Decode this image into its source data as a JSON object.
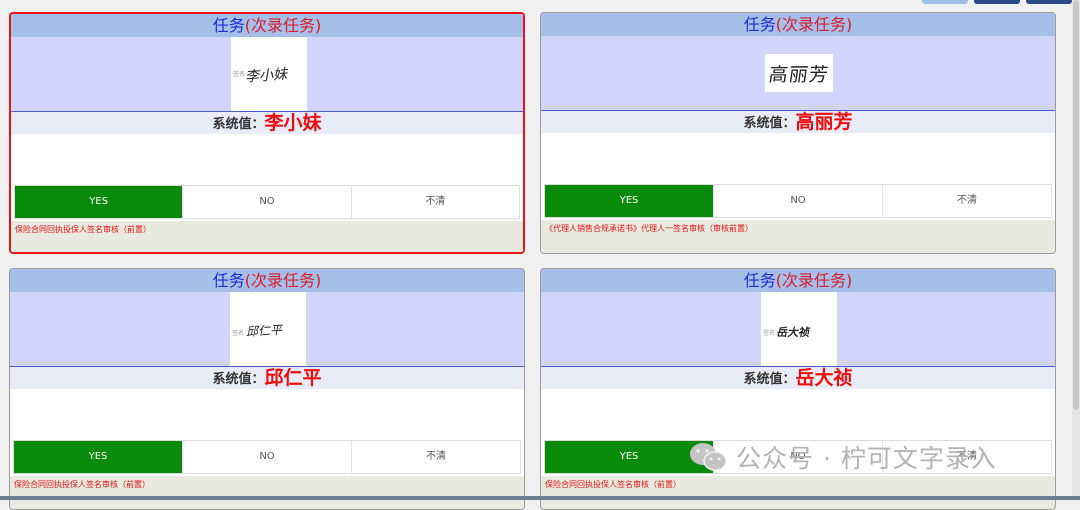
{
  "cards": [
    {
      "header_title": "任务",
      "header_sub": "(次录任务)",
      "sig_text": "李小妹",
      "sig_prefix": "签名",
      "sys_label": "系统值：",
      "sys_value": "李小妹",
      "options": [
        "YES",
        "NO",
        "不清"
      ],
      "selected_option": "YES",
      "footer_text": "保险合同回执投保人签名审核（前置）",
      "selected": true
    },
    {
      "header_title": "任务",
      "header_sub": "(次录任务)",
      "sig_text": "高丽芳",
      "sig_prefix": "",
      "sys_label": "系统值：",
      "sys_value": "高丽芳",
      "options": [
        "YES",
        "NO",
        "不清"
      ],
      "selected_option": "YES",
      "footer_text": "《代理人销售合规承诺书》代理人一签名审核（审核前置）",
      "selected": false
    },
    {
      "header_title": "任务",
      "header_sub": "(次录任务)",
      "sig_text": "邱仁平",
      "sig_prefix": "签名",
      "sys_label": "系统值：",
      "sys_value": "邱仁平",
      "options": [
        "YES",
        "NO",
        "不清"
      ],
      "selected_option": "YES",
      "footer_text": "保险合同回执投保人签名审核（前置）",
      "selected": false
    },
    {
      "header_title": "任务",
      "header_sub": "(次录任务)",
      "sig_text": "岳大祯",
      "sig_prefix": "签名",
      "sys_label": "系统值：",
      "sys_value": "岳大祯",
      "options": [
        "YES",
        "NO",
        "不清"
      ],
      "selected_option": "YES",
      "footer_text": "保险合同回执投保人签名审核（前置）",
      "selected": false
    }
  ],
  "watermark": {
    "text": "公众号 · 柠可文字录入",
    "icon": "wechat-icon"
  },
  "colors": {
    "selected_border": "#e8141a",
    "header_bg": "#a6bfe8",
    "image_area_bg": "#d2d5fb",
    "yes_active": "#0a8a0a",
    "value_red": "#f00b0b"
  }
}
